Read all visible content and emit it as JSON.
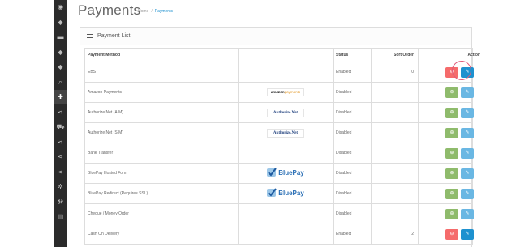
{
  "page": {
    "title": "Payments"
  },
  "breadcrumb": {
    "home": "Home",
    "separator": "/",
    "current": "Payments"
  },
  "panel": {
    "title": "Payment List"
  },
  "sidebar": {
    "icons": [
      "dashboard-icon",
      "tag-icon",
      "card-icon",
      "tags-icon",
      "tags-icon",
      "search-icon",
      "puzzle-icon",
      "share-icon",
      "cart-icon",
      "share-icon",
      "share-icon",
      "share-icon",
      "gear-icon",
      "wrench-icon",
      "chart-icon"
    ]
  },
  "table": {
    "headers": {
      "method": "Payment Method",
      "logo": "",
      "status": "Status",
      "sort": "Sort Order",
      "action": "Action"
    },
    "rows": [
      {
        "name": "EBS",
        "logo": "",
        "status": "Enabled",
        "sort": "0",
        "installed": true
      },
      {
        "name": "Amazon Payments",
        "logo": "amazon",
        "status": "Disabled",
        "sort": "",
        "installed": false
      },
      {
        "name": "Authorize.Net (AIM)",
        "logo": "authnet",
        "status": "Disabled",
        "sort": "",
        "installed": false
      },
      {
        "name": "Authorize.Net (SIM)",
        "logo": "authnet",
        "status": "Disabled",
        "sort": "",
        "installed": false
      },
      {
        "name": "Bank Transfer",
        "logo": "",
        "status": "Disabled",
        "sort": "",
        "installed": false
      },
      {
        "name": "BluePay Hosted Form",
        "logo": "bluepay",
        "status": "Disabled",
        "sort": "",
        "installed": false
      },
      {
        "name": "BluePay Redirect (Requires SSL)",
        "logo": "bluepay",
        "status": "Disabled",
        "sort": "",
        "installed": false
      },
      {
        "name": "Cheque / Money Order",
        "logo": "",
        "status": "Disabled",
        "sort": "",
        "installed": false
      },
      {
        "name": "Cash On Delivery",
        "logo": "",
        "status": "Enabled",
        "sort": "2",
        "installed": true
      }
    ]
  },
  "logos": {
    "amazon": {
      "brand": "amazon",
      "suffix": "payments"
    },
    "authnet": {
      "text": "Authorize.Net"
    },
    "bluepay": {
      "text": "BluePay"
    }
  },
  "colors": {
    "sidebar": "#2b2b2b",
    "install": "#8fbb6c",
    "uninstall": "#f56b6b",
    "edit": "#1e91cf",
    "edit_disabled": "#6ab7e3",
    "highlight": "#e05a7a"
  }
}
